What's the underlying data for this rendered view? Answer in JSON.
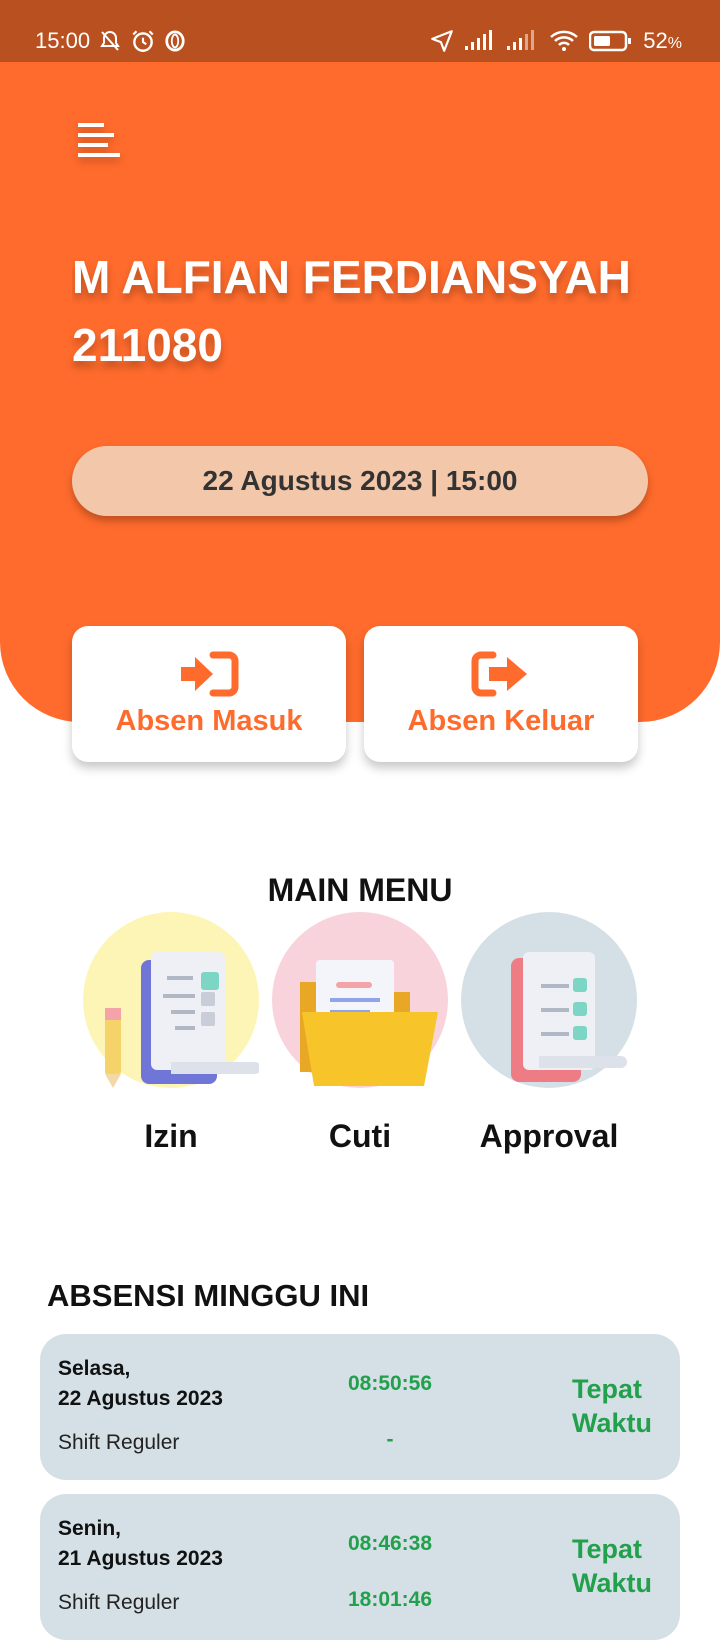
{
  "status_bar": {
    "time": "15:00",
    "battery": "52",
    "battery_unit": "%",
    "icons_left": [
      "mute-alarm-icon",
      "alarm-clock-icon",
      "opera-icon"
    ],
    "icons_right": [
      "location-icon",
      "signal-icon",
      "signal-icon",
      "wifi-icon",
      "battery-icon"
    ]
  },
  "header": {
    "menu_icon": "hamburger-menu-icon",
    "user_name": "M ALFIAN FERDIANSYAH",
    "user_id": "211080",
    "datetime": "22 Agustus 2023 | 15:00"
  },
  "attendance_buttons": {
    "clock_in_label": "Absen Masuk",
    "clock_out_label": "Absen Keluar"
  },
  "main_menu": {
    "title": "MAIN MENU",
    "items": [
      {
        "label": "Izin",
        "icon": "permission-document-icon"
      },
      {
        "label": "Cuti",
        "icon": "leave-folder-icon"
      },
      {
        "label": "Approval",
        "icon": "approval-checklist-icon"
      }
    ]
  },
  "weekly_attendance": {
    "title": "ABSENSI MINGGU INI",
    "records": [
      {
        "day": "Selasa,",
        "date": "22 Agustus 2023",
        "shift": "Shift Reguler",
        "time_in": "08:50:56",
        "time_out": "-",
        "status_line1": "Tepat",
        "status_line2": "Waktu"
      },
      {
        "day": "Senin,",
        "date": "21 Agustus 2023",
        "shift": "Shift Reguler",
        "time_in": "08:46:38",
        "time_out": "18:01:46",
        "status_line1": "Tepat",
        "status_line2": "Waktu"
      }
    ]
  },
  "colors": {
    "primary": "#FF6B2C",
    "status_bar": "#B9501F",
    "success": "#22A04B",
    "card_bg": "#D5E0E6",
    "pill_bg": "#F3C7AA"
  }
}
